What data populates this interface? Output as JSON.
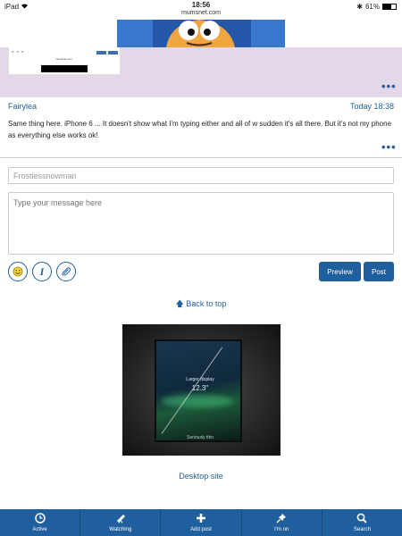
{
  "statusbar": {
    "device": "iPad",
    "time": "18:56",
    "url": "mumsnet.com",
    "battery": "61%",
    "battery_level": 0.61
  },
  "previous_post": {
    "thumb_text": "mumsnet.com"
  },
  "post": {
    "author": "Fairylea",
    "date": "Today 18:38",
    "body": "Same thing here. iPhone 6 ... It doesn't show what I'm typing either and all of w sudden it's all there. But it's not my phone as everything else works ok!"
  },
  "reply_form": {
    "name_value": "Frostiessnowman",
    "message_placeholder": "Type your message here",
    "preview_label": "Preview",
    "post_label": "Post"
  },
  "links": {
    "back_to_top": "Back to top",
    "desktop_site": "Desktop site"
  },
  "ad": {
    "line1": "Larger display",
    "line2": "12.3\"",
    "line3": "Seriously thin"
  },
  "tabbar": {
    "items": [
      {
        "label": "Active",
        "icon": "clock-icon"
      },
      {
        "label": "Watching",
        "icon": "telescope-icon"
      },
      {
        "label": "Add post",
        "icon": "plus-icon"
      },
      {
        "label": "I'm on",
        "icon": "pin-icon"
      },
      {
        "label": "Search",
        "icon": "search-icon"
      }
    ]
  },
  "colors": {
    "accent": "#1f5f9e",
    "highlight_post_bg": "#e3d8e8"
  }
}
